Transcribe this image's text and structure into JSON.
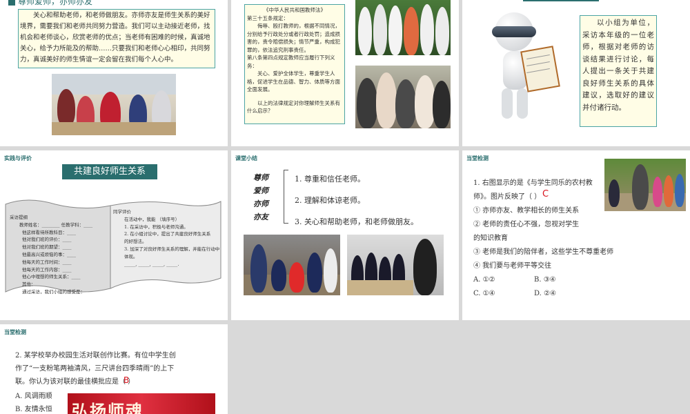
{
  "slides": {
    "s1": {
      "title": "尊师爱师，亦师亦友",
      "paragraph": "关心和帮助老师，和老师做朋友。亦师亦友是师生关系的美好境界，需要我们和老师共同努力营造。我们可以主动接近老师，找机会和老师谈心，欣赏老师的优点；当老师有困难的时候，真诚地关心，给予力所能及的帮助……只要我们和老师心心相印，共同努力，真诚美好的师生情谊一定会留在我们每个人心中。"
    },
    "s2": {
      "law_lines": [
        "《中华人民共和国教师法》",
        "第三十五条规定：",
        "侮辱、殴打教师的，根据不同情况，分别给予行政处分或者行政处罚；造成损害的，责令赔偿损失；情节严重，构成犯罪的，依法追究刑事责任。",
        "第八条第四点规定教师应当履行下列义务：",
        "关心、爱护全体学生，尊重学生人格，促进学生在品德、智力、体质等方面全面发展。",
        "以上的法律规定对你理解师生关系有什么启示？"
      ]
    },
    "s3": {
      "text": "以小组为单位，采访本年级的一位老师，根据对老师的访谈结果进行讨论，每人提出一条关于共建良好师生关系的具体建议，选取好的建议并付诸行动。"
    },
    "s4": {
      "header": "实践与评价",
      "banner": "共建良好师生关系",
      "left_lines": [
        "采访提纲",
        "教师姓名：________ 任教学科：____",
        "他这样看待所教科目：____",
        "他对我们班的评价：____",
        "他对我们班的期望：____",
        "他最高兴或烦恼的事：____",
        "他每天的工作时间：____",
        "他每天的工作内容：____",
        "他心中理想的师生关系：____",
        "其他：",
        "通过采访，我们小组的感受是："
      ],
      "right_lines": [
        "同学评价",
        "在活动中，我能  （填序号）",
        "1. 在采访中，积极与老师沟通。",
        "2. 在小组讨论中，提出了共建良好师生关系",
        "的好想法。",
        "3. 加深了对良好师生关系的理解，并能在行动中体现。",
        "_____, _____, _____, _____."
      ]
    },
    "s5": {
      "header": "课堂小结",
      "keywords": [
        "尊师",
        "爱师",
        "亦师",
        "亦友"
      ],
      "points": [
        "1. 尊重和信任老师。",
        "2. 理解和体谅老师。",
        "3. 关心和帮助老师，和老师做朋友。"
      ]
    },
    "s6": {
      "header": "当堂检测",
      "question": [
        "1. 右图显示的是《与学生同乐的农村教",
        "师》。图片反映了（      ）",
        "① 亦师亦友、教学相长的师生关系",
        "② 老师的责任心不强，忽视对学生",
        "的知识教育",
        "③ 老师是我们的陪伴者，这些学生不尊重老师",
        "④ 我们要与老师平等交往"
      ],
      "answer": "C",
      "options": [
        "A. ①②",
        "B. ③④",
        "C. ①④",
        "D. ②④"
      ]
    },
    "s7": {
      "header": "当堂检测",
      "question": [
        "2. 某学校举办校园生活对联创作比赛。有位中学生创",
        "作了“一支粉笔两袖清风，三尺讲台四季晴雨”的上下",
        "联。你认为该对联的最佳横批应是（      ）"
      ],
      "answer": "B",
      "options": [
        "A. 风调雨顺",
        "B. 友情永恒"
      ],
      "poster_text": "弘扬师魂"
    }
  },
  "colors": {
    "teal": "#2a6e6e",
    "accent_red": "#d9141e",
    "note_bg": "#fffde6"
  }
}
